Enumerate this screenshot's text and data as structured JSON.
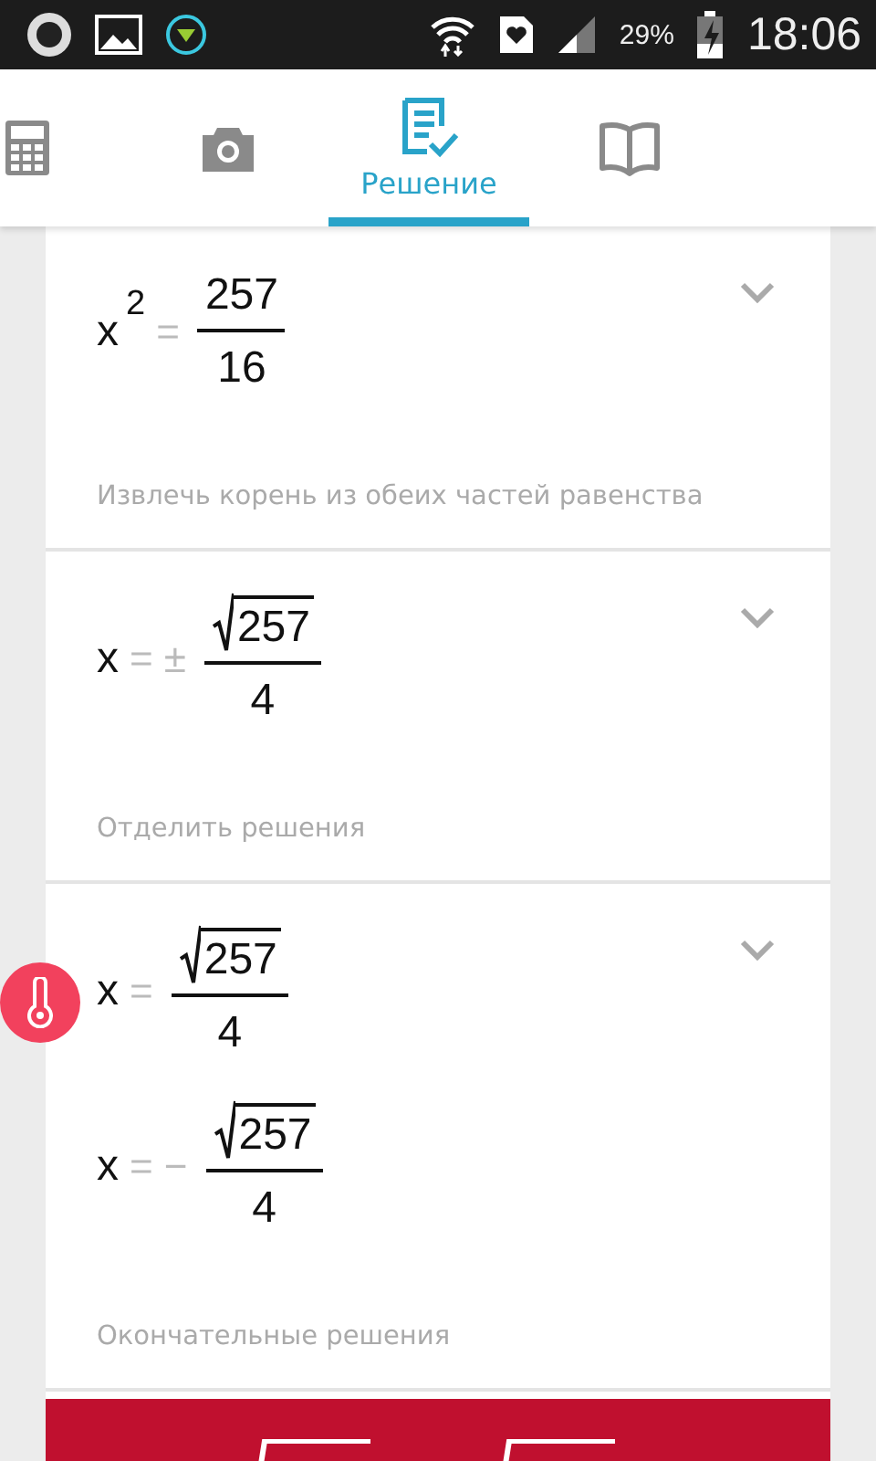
{
  "status_bar": {
    "battery": "29%",
    "time": "18:06"
  },
  "tabs": [
    {
      "kind": "calculator",
      "selected": false
    },
    {
      "kind": "camera",
      "selected": false
    },
    {
      "kind": "solution",
      "label": "Решение",
      "selected": true
    },
    {
      "kind": "book",
      "selected": false
    }
  ],
  "steps": [
    {
      "lines": [
        {
          "variable": "x",
          "exponent": "2",
          "operator": "=",
          "numerator": "257",
          "radical": false,
          "denominator": "16"
        }
      ],
      "caption": "Извлечь корень из обеих частей равенства"
    },
    {
      "lines": [
        {
          "variable": "x",
          "operator": "=",
          "sign": "±",
          "numerator": "257",
          "radical": true,
          "denominator": "4"
        }
      ],
      "caption": "Отделить решения"
    },
    {
      "lines": [
        {
          "variable": "x",
          "operator": "=",
          "numerator": "257",
          "radical": true,
          "denominator": "4"
        },
        {
          "variable": "x",
          "operator": "=",
          "sign": "−",
          "numerator": "257",
          "radical": true,
          "denominator": "4"
        }
      ],
      "caption": "Окончательные решения"
    }
  ]
}
